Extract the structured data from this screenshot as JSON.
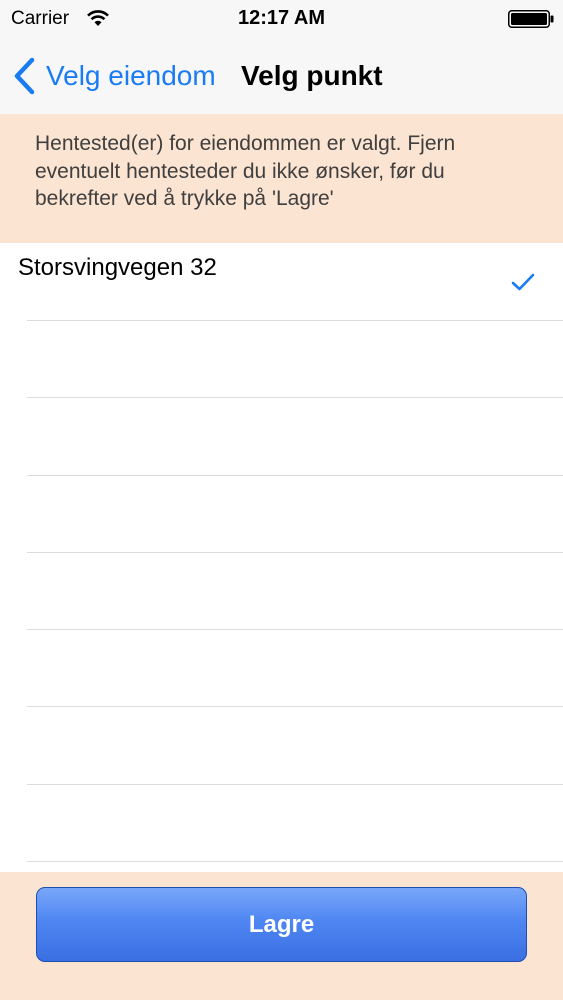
{
  "status_bar": {
    "carrier": "Carrier",
    "time": "12:17 AM",
    "icons": [
      "wifi-icon",
      "battery-icon"
    ]
  },
  "nav": {
    "back_label": "Velg eiendom",
    "title": "Velg punkt",
    "accent_color": "#1a7cf4"
  },
  "info": {
    "text_line_1": "Hentested(er) for eiendommen er valgt. Fjern",
    "text_line_2": "eventuelt hentesteder du ikke ønsker, før du",
    "text_line_3": "bekrefter ved å trykke på 'Lagre'",
    "background_color": "#fbe4d1"
  },
  "list": {
    "items": [
      {
        "label": "Storsvingvegen 32",
        "selected": true
      }
    ]
  },
  "footer": {
    "save_label": "Lagre",
    "button_color": "#4f86f2"
  }
}
